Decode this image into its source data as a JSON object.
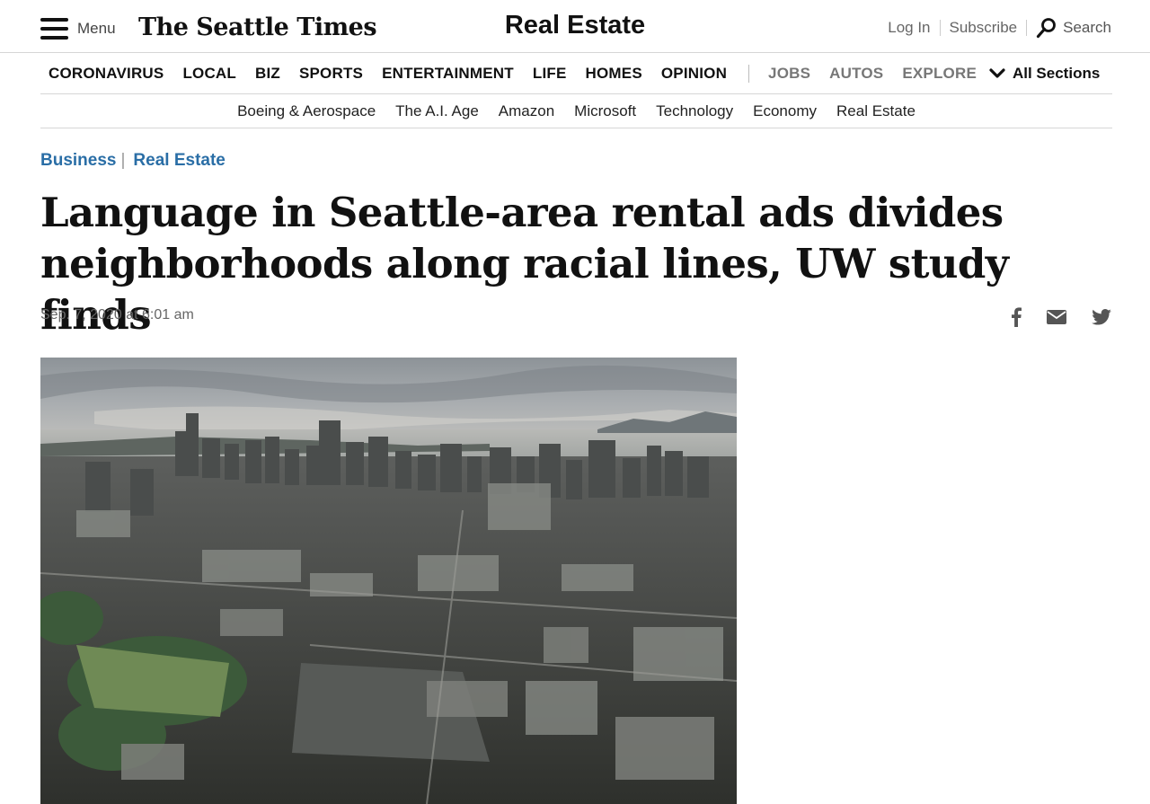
{
  "header": {
    "menu_label": "Menu",
    "logo_text": "The Seattle Times",
    "section_title": "Real Estate",
    "login_label": "Log In",
    "subscribe_label": "Subscribe",
    "search_label": "Search"
  },
  "main_nav": {
    "items": [
      "CORONAVIRUS",
      "LOCAL",
      "BIZ",
      "SPORTS",
      "ENTERTAINMENT",
      "LIFE",
      "HOMES",
      "OPINION"
    ],
    "secondary_items": [
      "JOBS",
      "AUTOS",
      "EXPLORE"
    ],
    "all_sections_label": "All Sections"
  },
  "sub_nav": {
    "items": [
      "Boeing & Aerospace",
      "The A.I. Age",
      "Amazon",
      "Microsoft",
      "Technology",
      "Economy",
      "Real Estate"
    ]
  },
  "article": {
    "breadcrumb": [
      "Business",
      "Real Estate"
    ],
    "headline": "Language in Seattle-area rental ads divides neighborhoods along racial lines, UW study finds",
    "dateline": "Sep. 7, 2020 at 6:01 am"
  },
  "share": {
    "icons": [
      "facebook-icon",
      "email-icon",
      "twitter-icon"
    ]
  },
  "colors": {
    "link_blue": "#2a6ea6",
    "text_dark": "#111111",
    "muted_gray": "#777777"
  }
}
